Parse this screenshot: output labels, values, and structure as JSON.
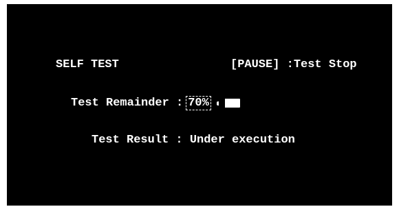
{
  "screen": {
    "title": "SELF TEST",
    "hint": "[PAUSE] :Test Stop"
  },
  "remainder": {
    "label": "Test Remainder :",
    "value": "70%",
    "level": 0.7,
    "icon": "battery-level-icon"
  },
  "result": {
    "text": "Test Result : Under execution"
  },
  "colors": {
    "background": "#000000",
    "text": "#ffffff"
  }
}
